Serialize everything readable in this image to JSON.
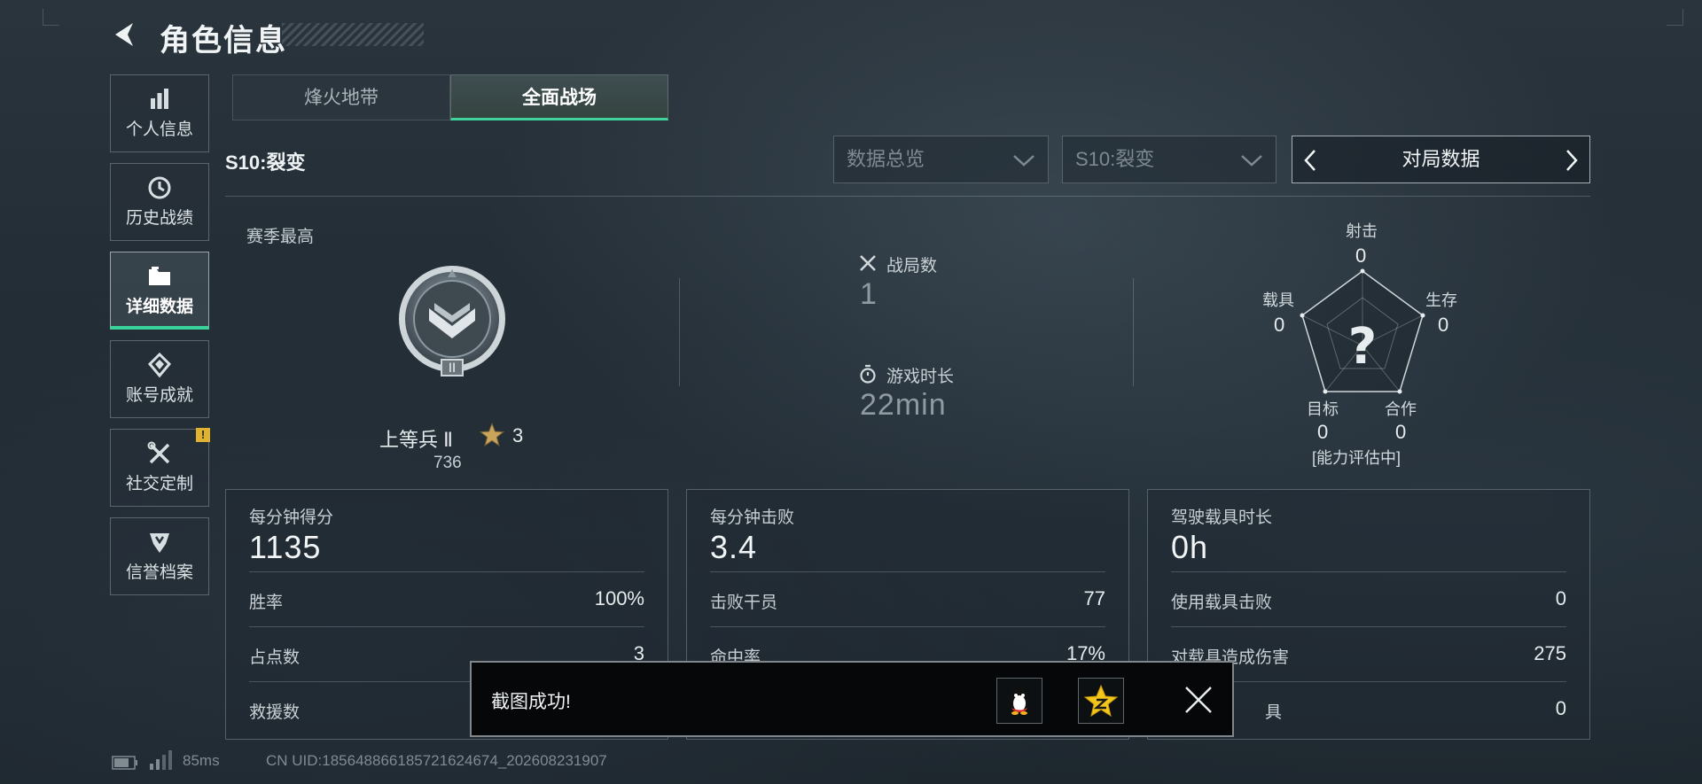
{
  "header": {
    "title": "角色信息"
  },
  "sidebar": {
    "items": [
      {
        "label": "个人信息",
        "icon": "bar-chart-icon"
      },
      {
        "label": "历史战绩",
        "icon": "clock-history-icon"
      },
      {
        "label": "详细数据",
        "icon": "folder-icon",
        "active": true
      },
      {
        "label": "账号成就",
        "icon": "medal-icon"
      },
      {
        "label": "社交定制",
        "icon": "tools-icon",
        "badge": "!"
      },
      {
        "label": "信誉档案",
        "icon": "shield-icon"
      }
    ]
  },
  "tabs": [
    {
      "label": "烽火地带"
    },
    {
      "label": "全面战场",
      "active": true
    }
  ],
  "season": {
    "label": "S10:裂变"
  },
  "filters": {
    "overview": "数据总览",
    "season": "S10:裂变",
    "pager_label": "对局数据"
  },
  "season_best": {
    "label": "赛季最高",
    "rank_name": "上等兵 Ⅱ",
    "stars": "3",
    "points": "736",
    "emblem_tier": "II"
  },
  "summary": {
    "matches_label": "战局数",
    "matches_value": "1",
    "playtime_label": "游戏时长",
    "playtime_value": "22min"
  },
  "radar": {
    "center": "?",
    "shooting_label": "射击",
    "shooting_value": "0",
    "survival_label": "生存",
    "survival_value": "0",
    "teamwork_label": "合作",
    "teamwork_value": "0",
    "objective_label": "目标",
    "objective_value": "0",
    "vehicle_label": "载具",
    "vehicle_value": "0",
    "status": "[能力评估中]"
  },
  "cards": [
    {
      "head_label": "每分钟得分",
      "head_value": "1135",
      "rows": [
        {
          "label": "胜率",
          "value": "100%"
        },
        {
          "label": "占点数",
          "value": "3"
        },
        {
          "label": "救援数",
          "value": ""
        }
      ]
    },
    {
      "head_label": "每分钟击败",
      "head_value": "3.4",
      "rows": [
        {
          "label": "击败干员",
          "value": "77"
        },
        {
          "label": "命中率",
          "value": "17%"
        }
      ]
    },
    {
      "head_label": "驾驶载具时长",
      "head_value": "0h",
      "rows": [
        {
          "label": "使用载具击败",
          "value": "0"
        },
        {
          "label": "对载具造成伤害",
          "value": "275"
        },
        {
          "label": "具",
          "value": "0"
        }
      ]
    }
  ],
  "toast": {
    "message": "截图成功!",
    "share_qq": "qq-penguin-icon",
    "share_qzone": "qzone-star-icon"
  },
  "status_bar": {
    "ping": "85ms",
    "uid": "CN UID:18564886618572162467​4_202608231907"
  },
  "colors": {
    "accent": "#39d29a",
    "badge": "#e0b230",
    "background": "#222c34"
  }
}
